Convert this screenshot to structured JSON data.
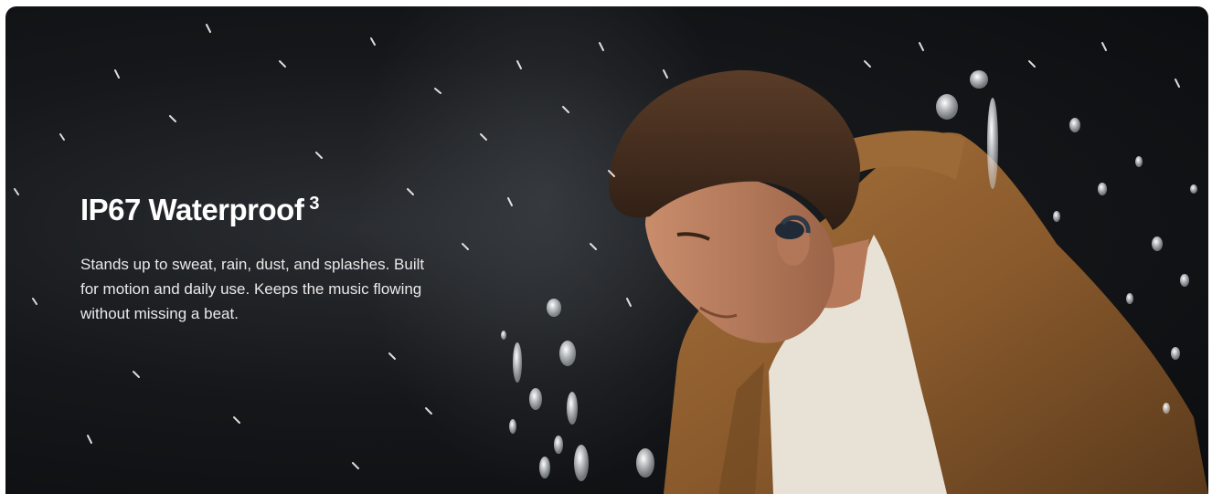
{
  "hero": {
    "headline": "IP67 Waterproof",
    "footnote_marker": "3",
    "description": "Stands up to sweat, rain, dust, and splashes. Built for motion and daily use. Keeps the music flowing without missing a beat.",
    "image_alt": "Man in a brown jacket wearing an earbud, surrounded by water splashes"
  },
  "colors": {
    "background": "#0b0c0e",
    "text": "#ffffff",
    "jacket": "#8a5a2c",
    "shirt": "#e8e2d6"
  }
}
